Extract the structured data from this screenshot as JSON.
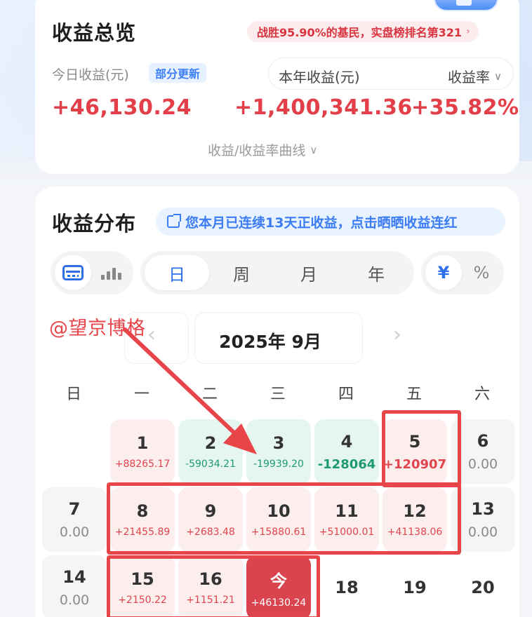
{
  "overview": {
    "title": "收益总览",
    "rank_badge": "战胜95.90%的基民，实盘榜排名第321",
    "today_label": "今日收益(元)",
    "update_tag": "部分更新",
    "year_label": "本年收益(元)",
    "rate_label": "收益率",
    "today_value": "+46,130.24",
    "year_value": "+1,400,341.36",
    "rate_value": "+35.82%",
    "curve_link": "收益/收益率曲线"
  },
  "distribution": {
    "title": "收益分布",
    "streak_text": "您本月已连续13天正收益，点击晒晒收益连红",
    "periods": [
      "日",
      "周",
      "月",
      "年"
    ],
    "active_period": "日",
    "units": [
      "¥",
      "%"
    ],
    "month_label": "2025年 9月",
    "weekdays": [
      "日",
      "一",
      "二",
      "三",
      "四",
      "五",
      "六"
    ],
    "days": [
      {
        "d": "1",
        "v": "+88265.17",
        "type": "pos"
      },
      {
        "d": "2",
        "v": "-59034.21",
        "type": "neg"
      },
      {
        "d": "3",
        "v": "-19939.20",
        "type": "neg"
      },
      {
        "d": "4",
        "v": "-128064",
        "type": "neg"
      },
      {
        "d": "5",
        "v": "+120907",
        "type": "pos"
      },
      {
        "d": "6",
        "v": "0.00",
        "type": "zero"
      },
      {
        "d": "7",
        "v": "0.00",
        "type": "zero"
      },
      {
        "d": "8",
        "v": "+21455.89",
        "type": "pos"
      },
      {
        "d": "9",
        "v": "+2683.48",
        "type": "pos"
      },
      {
        "d": "10",
        "v": "+15880.61",
        "type": "pos"
      },
      {
        "d": "11",
        "v": "+51000.01",
        "type": "pos"
      },
      {
        "d": "12",
        "v": "+41138.06",
        "type": "pos"
      },
      {
        "d": "13",
        "v": "0.00",
        "type": "zero"
      },
      {
        "d": "14",
        "v": "0.00",
        "type": "zero"
      },
      {
        "d": "15",
        "v": "+2150.22",
        "type": "pos"
      },
      {
        "d": "16",
        "v": "+1151.21",
        "type": "pos"
      },
      {
        "d": "今",
        "v": "+46130.24",
        "type": "today"
      },
      {
        "d": "18",
        "v": "",
        "type": "empty"
      },
      {
        "d": "19",
        "v": "",
        "type": "empty"
      },
      {
        "d": "20",
        "v": "",
        "type": "empty"
      }
    ]
  },
  "annotation": {
    "watermark": "@望京博格",
    "colors": {
      "highlight": "#e8454a",
      "positive": "#e0444c",
      "negative": "#1f9a70",
      "accent": "#2f6fe8"
    }
  }
}
